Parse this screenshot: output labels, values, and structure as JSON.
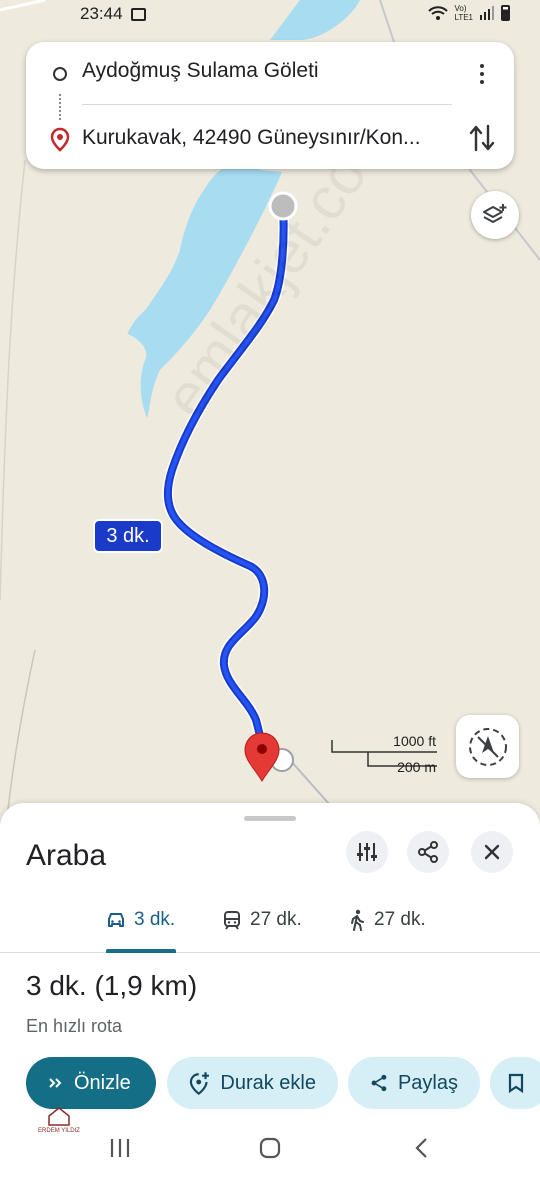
{
  "status_bar": {
    "time": "23:44",
    "network_label": "Vo)\nLTE1"
  },
  "directions": {
    "origin": "Aydoğmuş Sulama Göleti",
    "destination": "Kurukavak, 42490 Güneysınır/Kon..."
  },
  "map": {
    "route_time_label": "3 dk.",
    "scale_ft": "1000 ft",
    "scale_m": "200 m",
    "route_color": "#1a3bc7",
    "water_color": "#a7dcf1",
    "land_color": "#eeeadd",
    "watermark": "emlakjet.com"
  },
  "sheet": {
    "title": "Araba",
    "tabs": [
      {
        "icon": "car-icon",
        "label": "3 dk."
      },
      {
        "icon": "transit-icon",
        "label": "27 dk."
      },
      {
        "icon": "walk-icon",
        "label": "27 dk."
      }
    ],
    "route_summary": "3 dk. (1,9 km)",
    "route_note": "En hızlı rota",
    "actions": {
      "preview": "Önizle",
      "add_stop": "Durak ekle",
      "share": "Paylaş"
    }
  },
  "logo": {
    "name": "ERDEM YILDIZ"
  }
}
